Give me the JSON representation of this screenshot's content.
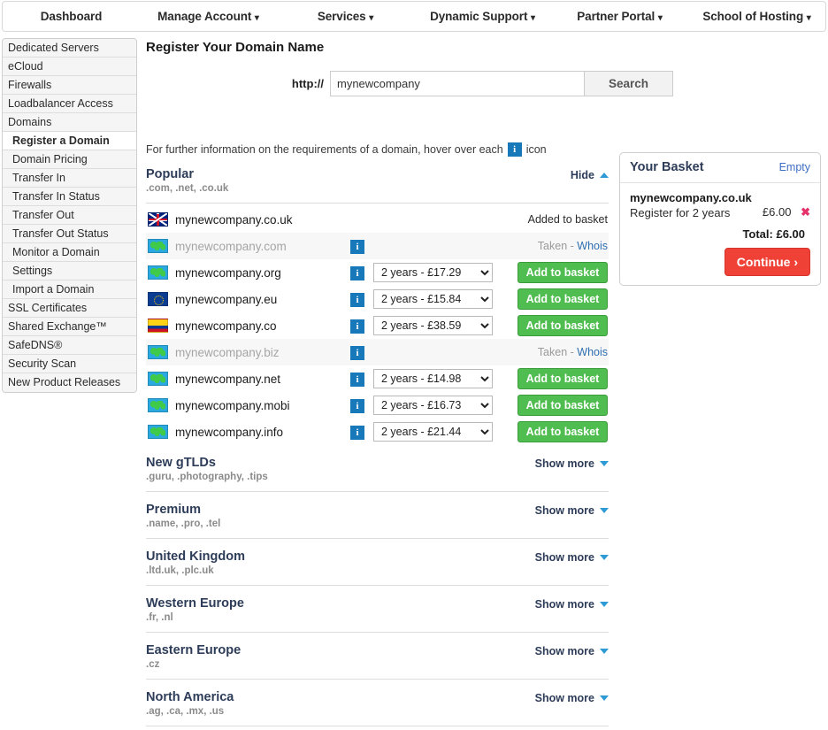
{
  "topnav": {
    "items": [
      {
        "label": "Dashboard",
        "caret": false
      },
      {
        "label": "Manage Account",
        "caret": true
      },
      {
        "label": "Services",
        "caret": true
      },
      {
        "label": "Dynamic Support",
        "caret": true
      },
      {
        "label": "Partner Portal",
        "caret": true
      },
      {
        "label": "School of Hosting",
        "caret": true
      }
    ],
    "caret_glyph": "▾"
  },
  "sidebar": {
    "items": [
      {
        "label": "Dedicated Servers",
        "sub": false,
        "active": false
      },
      {
        "label": "eCloud",
        "sub": false,
        "active": false
      },
      {
        "label": "Firewalls",
        "sub": false,
        "active": false
      },
      {
        "label": "Loadbalancer Access",
        "sub": false,
        "active": false
      },
      {
        "label": "Domains",
        "sub": false,
        "active": false
      },
      {
        "label": "Register a Domain",
        "sub": true,
        "active": true
      },
      {
        "label": "Domain Pricing",
        "sub": true,
        "active": false
      },
      {
        "label": "Transfer In",
        "sub": true,
        "active": false
      },
      {
        "label": "Transfer In Status",
        "sub": true,
        "active": false
      },
      {
        "label": "Transfer Out",
        "sub": true,
        "active": false
      },
      {
        "label": "Transfer Out Status",
        "sub": true,
        "active": false
      },
      {
        "label": "Monitor a Domain",
        "sub": true,
        "active": false
      },
      {
        "label": "Settings",
        "sub": true,
        "active": false
      },
      {
        "label": "Import a Domain",
        "sub": true,
        "active": false
      },
      {
        "label": "SSL Certificates",
        "sub": false,
        "active": false
      },
      {
        "label": "Shared Exchange™",
        "sub": false,
        "active": false
      },
      {
        "label": "SafeDNS®",
        "sub": false,
        "active": false
      },
      {
        "label": "Security Scan",
        "sub": false,
        "active": false
      },
      {
        "label": "New Product Releases",
        "sub": false,
        "active": false
      }
    ]
  },
  "main": {
    "title": "Register Your Domain Name",
    "search": {
      "protocol_label": "http://",
      "value": "mynewcompany",
      "placeholder": "",
      "button_label": "Search"
    },
    "hover_note_before": "For further information on the requirements of a domain, hover over each",
    "hover_note_after": "icon",
    "info_icon_glyph": "i"
  },
  "sections": [
    {
      "name": "Popular",
      "subtitle": ".com, .net, .co.uk",
      "toggle_label": "Hide",
      "expanded": true
    },
    {
      "name": "New gTLDs",
      "subtitle": ".guru, .photography, .tips",
      "toggle_label": "Show more",
      "expanded": false
    },
    {
      "name": "Premium",
      "subtitle": ".name, .pro, .tel",
      "toggle_label": "Show more",
      "expanded": false
    },
    {
      "name": "United Kingdom",
      "subtitle": ".ltd.uk, .plc.uk",
      "toggle_label": "Show more",
      "expanded": false
    },
    {
      "name": "Western Europe",
      "subtitle": ".fr, .nl",
      "toggle_label": "Show more",
      "expanded": false
    },
    {
      "name": "Eastern Europe",
      "subtitle": ".cz",
      "toggle_label": "Show more",
      "expanded": false
    },
    {
      "name": "North America",
      "subtitle": ".ag, .ca, .mx, .us",
      "toggle_label": "Show more",
      "expanded": false
    }
  ],
  "domains": [
    {
      "name": "mynewcompany.co.uk",
      "flag": "uk-flag-icon",
      "flag_class": "flag-uk",
      "state": "added",
      "status_text": "Added to basket",
      "has_info": false,
      "term": ""
    },
    {
      "name": "mynewcompany.com",
      "flag": "globe-flag-icon",
      "flag_class": "flag-globe",
      "state": "taken",
      "status_text": "Taken - ",
      "status_link": "Whois",
      "has_info": true,
      "term": ""
    },
    {
      "name": "mynewcompany.org",
      "flag": "globe-flag-icon",
      "flag_class": "flag-globe",
      "state": "available",
      "has_info": true,
      "term": "2 years - £17.29",
      "button_label": "Add to basket"
    },
    {
      "name": "mynewcompany.eu",
      "flag": "eu-flag-icon",
      "flag_class": "flag-eu",
      "state": "available",
      "has_info": true,
      "term": "2 years - £15.84",
      "button_label": "Add to basket"
    },
    {
      "name": "mynewcompany.co",
      "flag": "colombia-flag-icon",
      "flag_class": "flag-co",
      "state": "available",
      "has_info": true,
      "term": "2 years - £38.59",
      "button_label": "Add to basket"
    },
    {
      "name": "mynewcompany.biz",
      "flag": "globe-flag-icon",
      "flag_class": "flag-globe",
      "state": "taken",
      "status_text": "Taken - ",
      "status_link": "Whois",
      "has_info": true,
      "term": ""
    },
    {
      "name": "mynewcompany.net",
      "flag": "globe-flag-icon",
      "flag_class": "flag-globe",
      "state": "available",
      "has_info": true,
      "term": "2 years - £14.98",
      "button_label": "Add to basket"
    },
    {
      "name": "mynewcompany.mobi",
      "flag": "globe-flag-icon",
      "flag_class": "flag-globe",
      "state": "available",
      "has_info": true,
      "term": "2 years - £16.73",
      "button_label": "Add to basket"
    },
    {
      "name": "mynewcompany.info",
      "flag": "globe-flag-icon",
      "flag_class": "flag-globe",
      "state": "available",
      "has_info": true,
      "term": "2 years - £21.44",
      "button_label": "Add to basket"
    }
  ],
  "basket": {
    "title": "Your Basket",
    "empty_label": "Empty",
    "item_name": "mynewcompany.co.uk",
    "item_desc": "Register for 2 years",
    "item_price": "£6.00",
    "remove_glyph": "✖",
    "total_label": "Total: £6.00",
    "continue_label": "Continue ›"
  },
  "colors": {
    "accent_blue": "#1779ba",
    "link_blue": "#2f6fb0",
    "chevron_blue": "#2e9bd6",
    "heading_navy": "#2d3c58",
    "add_green": "#4fbd4f",
    "continue_red": "#ef4136",
    "remove_pink": "#e5326b"
  }
}
